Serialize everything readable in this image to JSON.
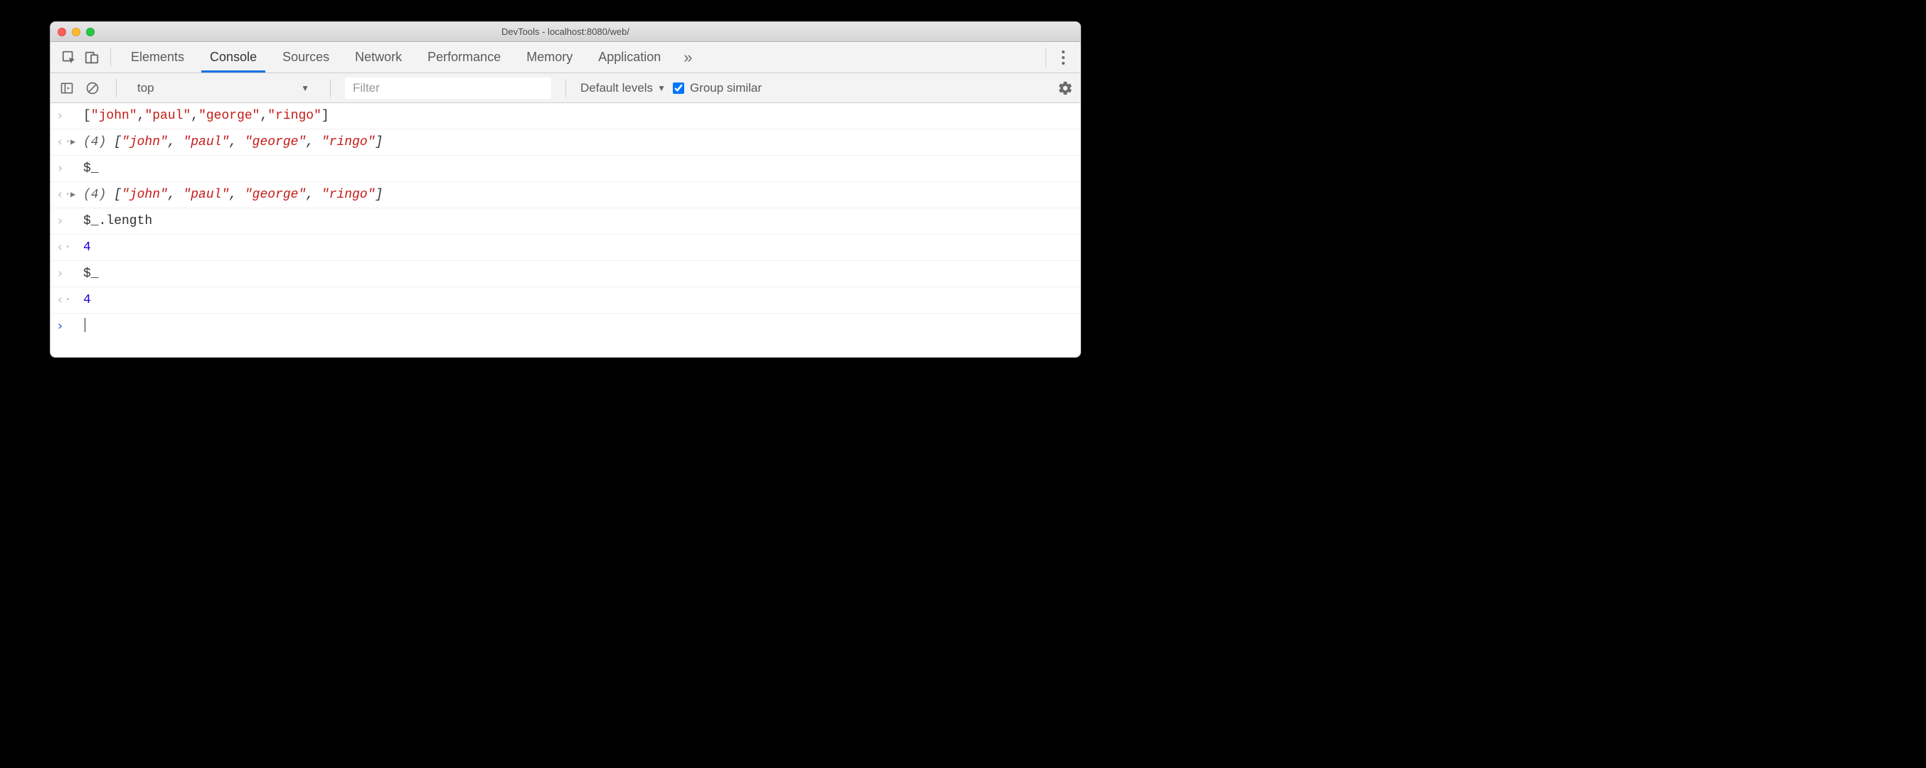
{
  "window": {
    "title": "DevTools - localhost:8080/web/"
  },
  "tabs": {
    "items": [
      "Elements",
      "Console",
      "Sources",
      "Network",
      "Performance",
      "Memory",
      "Application"
    ],
    "active_index": 1
  },
  "toolbar": {
    "context": "top",
    "filter_placeholder": "Filter",
    "filter_value": "",
    "levels_label": "Default levels",
    "group_similar_label": "Group similar",
    "group_similar_checked": true
  },
  "console": {
    "rows": [
      {
        "kind": "input-past",
        "segments": [
          {
            "t": "[",
            "c": "punct"
          },
          {
            "t": "\"john\"",
            "c": "str"
          },
          {
            "t": ",",
            "c": "punct"
          },
          {
            "t": "\"paul\"",
            "c": "str"
          },
          {
            "t": ",",
            "c": "punct"
          },
          {
            "t": "\"george\"",
            "c": "str"
          },
          {
            "t": ",",
            "c": "punct"
          },
          {
            "t": "\"ringo\"",
            "c": "str"
          },
          {
            "t": "]",
            "c": "punct"
          }
        ]
      },
      {
        "kind": "result",
        "expandable": true,
        "segments": [
          {
            "t": "(4) ",
            "c": "dim-italic"
          },
          {
            "t": "[",
            "c": "italic punct"
          },
          {
            "t": "\"john\"",
            "c": "italic str"
          },
          {
            "t": ", ",
            "c": "italic punct"
          },
          {
            "t": "\"paul\"",
            "c": "italic str"
          },
          {
            "t": ", ",
            "c": "italic punct"
          },
          {
            "t": "\"george\"",
            "c": "italic str"
          },
          {
            "t": ", ",
            "c": "italic punct"
          },
          {
            "t": "\"ringo\"",
            "c": "italic str"
          },
          {
            "t": "]",
            "c": "italic punct"
          }
        ]
      },
      {
        "kind": "input-past",
        "segments": [
          {
            "t": "$_",
            "c": "punct"
          }
        ]
      },
      {
        "kind": "result",
        "expandable": true,
        "segments": [
          {
            "t": "(4) ",
            "c": "dim-italic"
          },
          {
            "t": "[",
            "c": "italic punct"
          },
          {
            "t": "\"john\"",
            "c": "italic str"
          },
          {
            "t": ", ",
            "c": "italic punct"
          },
          {
            "t": "\"paul\"",
            "c": "italic str"
          },
          {
            "t": ", ",
            "c": "italic punct"
          },
          {
            "t": "\"george\"",
            "c": "italic str"
          },
          {
            "t": ", ",
            "c": "italic punct"
          },
          {
            "t": "\"ringo\"",
            "c": "italic str"
          },
          {
            "t": "]",
            "c": "italic punct"
          }
        ]
      },
      {
        "kind": "input-past",
        "segments": [
          {
            "t": "$_.length",
            "c": "punct"
          }
        ]
      },
      {
        "kind": "result",
        "expandable": false,
        "segments": [
          {
            "t": "4",
            "c": "num"
          }
        ]
      },
      {
        "kind": "input-past",
        "segments": [
          {
            "t": "$_",
            "c": "punct"
          }
        ]
      },
      {
        "kind": "result",
        "expandable": false,
        "segments": [
          {
            "t": "4",
            "c": "num"
          }
        ]
      },
      {
        "kind": "input-current",
        "segments": []
      }
    ]
  }
}
